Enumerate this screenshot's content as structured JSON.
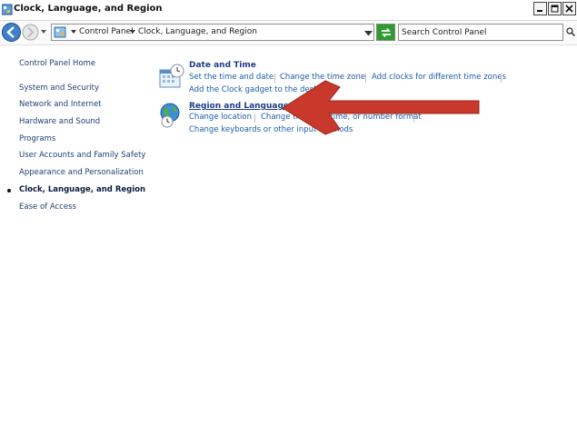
{
  "window": {
    "title": "Clock, Language, and Region",
    "icon": "control-panel-icon",
    "controls": [
      "minimize",
      "maximize",
      "close"
    ]
  },
  "address_bar": {
    "crumbs": [
      "Control Panel",
      "Clock, Language, and Region"
    ],
    "search_placeholder": "Search Control Panel"
  },
  "sidebar": {
    "items": [
      {
        "label": "Control Panel Home",
        "current": false
      },
      {
        "label": "System and Security",
        "current": false
      },
      {
        "label": "Network and Internet",
        "current": false
      },
      {
        "label": "Hardware and Sound",
        "current": false
      },
      {
        "label": "Programs",
        "current": false
      },
      {
        "label": "User Accounts and Family Safety",
        "current": false
      },
      {
        "label": "Appearance and Personalization",
        "current": false
      },
      {
        "label": "Clock, Language, and Region",
        "current": true
      },
      {
        "label": "Ease of Access",
        "current": false
      }
    ]
  },
  "categories": [
    {
      "title": "Date and Time",
      "icon": "calendar-clock-icon",
      "tasks": [
        "Set the time and date",
        "Change the time zone",
        "Add clocks for different time zones",
        "Add the Clock gadget to the desktop"
      ]
    },
    {
      "title": "Region and Language",
      "icon": "globe-clock-icon",
      "tasks": [
        "Change location",
        "Change the date, time, or number format",
        "Change keyboards or other input methods"
      ]
    }
  ],
  "annotation": {
    "type": "arrow",
    "color": "#c0392b",
    "points_to": "Region and Language"
  }
}
